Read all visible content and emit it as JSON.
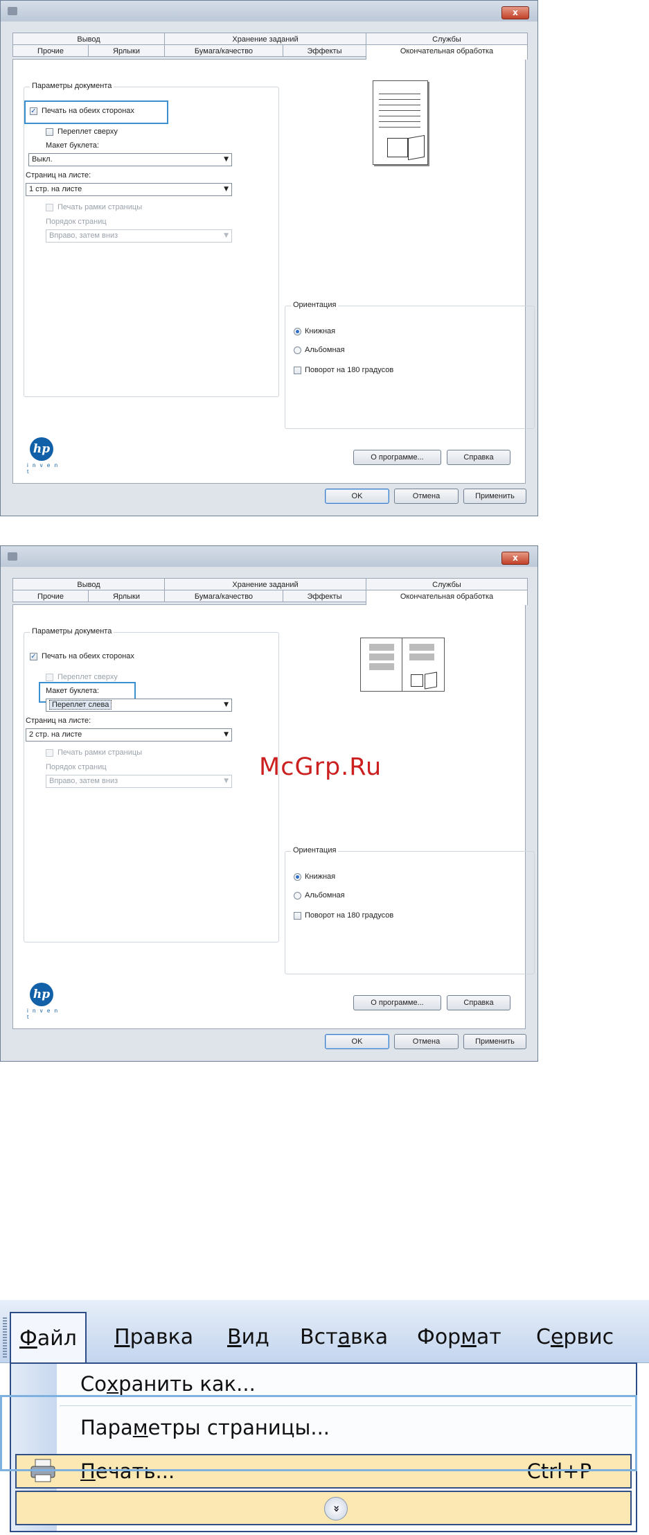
{
  "dialogs": [
    {
      "tabs_row1": [
        "Вывод",
        "Хранение заданий",
        "Службы"
      ],
      "tabs_row2": [
        "Прочие",
        "Ярлыки",
        "Бумага/качество",
        "Эффекты",
        "Окончательная обработка"
      ],
      "doc_group_title": "Параметры документа",
      "duplex_label": "Печать на обеих сторонах",
      "duplex_checked": true,
      "flip_up_label": "Переплет сверху",
      "booklet_label": "Макет буклета:",
      "booklet_value": "Выкл.",
      "pages_per_sheet_label": "Страниц на листе:",
      "pages_per_sheet_value": "1 стр. на листе",
      "print_borders_label": "Печать рамки страницы",
      "page_order_label": "Порядок страниц",
      "page_order_value": "Вправо, затем вниз",
      "orientation_title": "Ориентация",
      "portrait_label": "Книжная",
      "landscape_label": "Альбомная",
      "rotate_label": "Поворот на 180 градусов",
      "about_button": "О программе...",
      "help_button": "Справка",
      "ok_button": "OK",
      "cancel_button": "Отмена",
      "apply_button": "Применить",
      "hp_dots": "i n v e n t",
      "close_glyph": "x"
    },
    {
      "tabs_row1": [
        "Вывод",
        "Хранение заданий",
        "Службы"
      ],
      "tabs_row2": [
        "Прочие",
        "Ярлыки",
        "Бумага/качество",
        "Эффекты",
        "Окончательная обработка"
      ],
      "doc_group_title": "Параметры документа",
      "duplex_label": "Печать на обеих сторонах",
      "duplex_checked": true,
      "flip_up_label": "Переплет сверху",
      "booklet_label": "Макет буклета:",
      "booklet_value": "Переплет слева",
      "pages_per_sheet_label": "Страниц на листе:",
      "pages_per_sheet_value": "2 стр. на листе",
      "print_borders_label": "Печать рамки страницы",
      "page_order_label": "Порядок страниц",
      "page_order_value": "Вправо, затем вниз",
      "orientation_title": "Ориентация",
      "portrait_label": "Книжная",
      "landscape_label": "Альбомная",
      "rotate_label": "Поворот на 180 градусов",
      "about_button": "О программе...",
      "help_button": "Справка",
      "ok_button": "OK",
      "cancel_button": "Отмена",
      "apply_button": "Применить",
      "hp_dots": "i n v e n t",
      "close_glyph": "x"
    }
  ],
  "watermark": "McGrp.Ru",
  "menu": {
    "bar": [
      {
        "pre": "",
        "u": "Ф",
        "post": "айл"
      },
      {
        "pre": "",
        "u": "П",
        "post": "равка"
      },
      {
        "pre": "",
        "u": "В",
        "post": "ид"
      },
      {
        "pre": "Вст",
        "u": "а",
        "post": "вка"
      },
      {
        "pre": "Фор",
        "u": "м",
        "post": "ат"
      },
      {
        "pre": "С",
        "u": "е",
        "post": "рвис"
      }
    ],
    "items": [
      {
        "pre": "Со",
        "u": "х",
        "post": "ранить как..."
      },
      {
        "pre": "Пара",
        "u": "м",
        "post": "етры страницы..."
      },
      {
        "pre": "",
        "u": "П",
        "post": "ечать..."
      }
    ],
    "print_shortcut": "Ctrl+P",
    "expand_glyph": "»"
  },
  "colors": {
    "highlight": "#3a8fd1",
    "menu_hot": "#fbe8b3",
    "hp_blue": "#1160a8"
  }
}
